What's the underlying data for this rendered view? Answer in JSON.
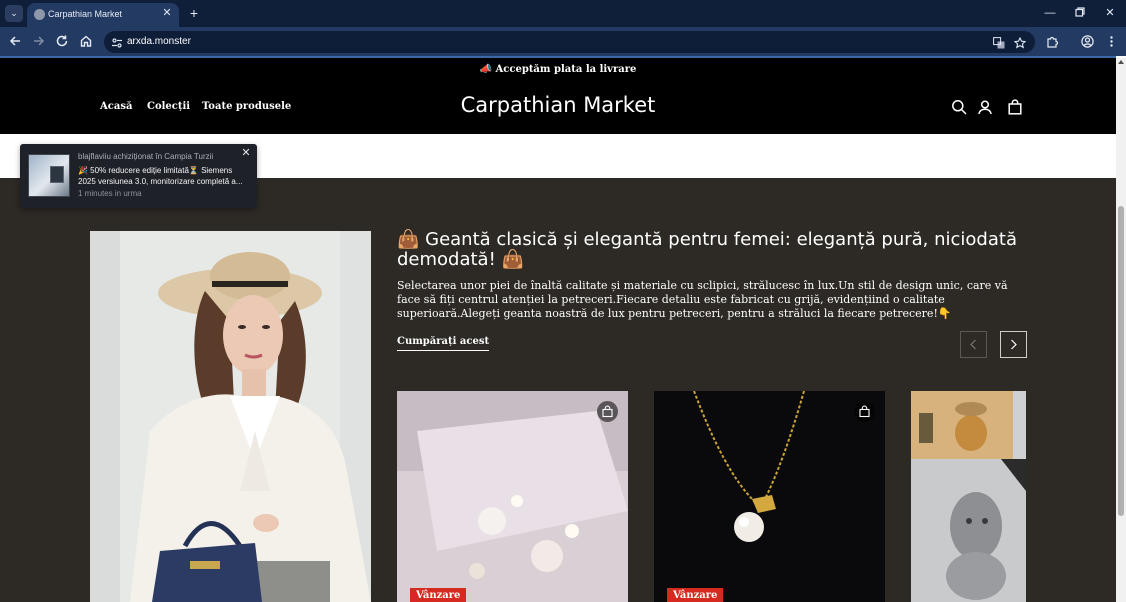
{
  "browser": {
    "tab_title": "Carpathian Market",
    "url": "arxda.monster"
  },
  "site": {
    "announcement": "📣 Acceptăm plata la livrare",
    "logo": "Carpathian Market",
    "nav": [
      "Acasă",
      "Colecții",
      "Toate produsele"
    ]
  },
  "toast": {
    "header": "blajflaviiu achiziționat în Campia Turzii",
    "body": "🎉 50% reducere ediție limitată⏳ Siemens 2025 versiunea 3.0, monitorizare completă a...",
    "time": "1 minutes in urma"
  },
  "feature": {
    "title": "👜 Geantă clasică și elegantă pentru femei: eleganță pură, niciodată demodată! 👜",
    "description": "Selectarea unor piei de înaltă calitate și materiale cu sclipici, strălucesc în lux.Un stil de design unic, care vă face să fiți centrul atenției la petreceri.Fiecare detaliu este fabricat cu grijă, evidențiind o calitate superioară.Alegeți geanta noastră de lux pentru petreceri, pentru a străluci la fiecare petrecere!👇",
    "shop_link": "Cumpărați acest"
  },
  "products": [
    {
      "badge": "Vânzare"
    },
    {
      "badge": "Vânzare"
    },
    {
      "badge": ""
    }
  ],
  "colors": {
    "announcement_bg": "#000000",
    "section_bg": "#2d2925",
    "sale_badge": "#d62a20",
    "chrome_bg": "#0f1f3a"
  }
}
